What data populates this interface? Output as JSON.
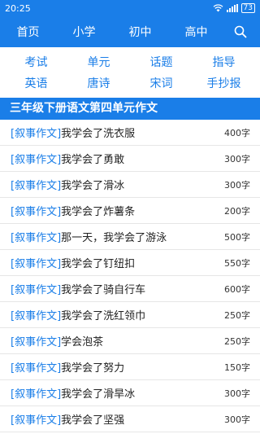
{
  "status": {
    "time": "20:25",
    "battery": "73"
  },
  "nav": {
    "items": [
      "首页",
      "小学",
      "初中",
      "高中"
    ]
  },
  "categories": [
    "考试",
    "单元",
    "话题",
    "指导",
    "英语",
    "唐诗",
    "宋词",
    "手抄报"
  ],
  "section": {
    "title": "三年级下册语文第四单元作文"
  },
  "articles": [
    {
      "tag": "[叙事作文]",
      "title": "我学会了洗衣服",
      "count": "400字"
    },
    {
      "tag": "[叙事作文]",
      "title": "我学会了勇敢",
      "count": "300字"
    },
    {
      "tag": "[叙事作文]",
      "title": "我学会了滑冰",
      "count": "300字"
    },
    {
      "tag": "[叙事作文]",
      "title": "我学会了炸薯条",
      "count": "200字"
    },
    {
      "tag": "[叙事作文]",
      "title": "那一天，我学会了游泳",
      "count": "500字"
    },
    {
      "tag": "[叙事作文]",
      "title": "我学会了钉纽扣",
      "count": "550字"
    },
    {
      "tag": "[叙事作文]",
      "title": "我学会了骑自行车",
      "count": "600字"
    },
    {
      "tag": "[叙事作文]",
      "title": "我学会了洗红领巾",
      "count": "250字"
    },
    {
      "tag": "[叙事作文]",
      "title": "学会泡茶",
      "count": "250字"
    },
    {
      "tag": "[叙事作文]",
      "title": "我学会了努力",
      "count": "150字"
    },
    {
      "tag": "[叙事作文]",
      "title": "我学会了滑旱冰",
      "count": "300字"
    },
    {
      "tag": "[叙事作文]",
      "title": "我学会了坚强",
      "count": "300字"
    }
  ],
  "colors": {
    "accent": "#1a7ee8"
  },
  "icons": [
    "wifi-icon",
    "signal-icon",
    "battery-icon",
    "search-icon"
  ]
}
